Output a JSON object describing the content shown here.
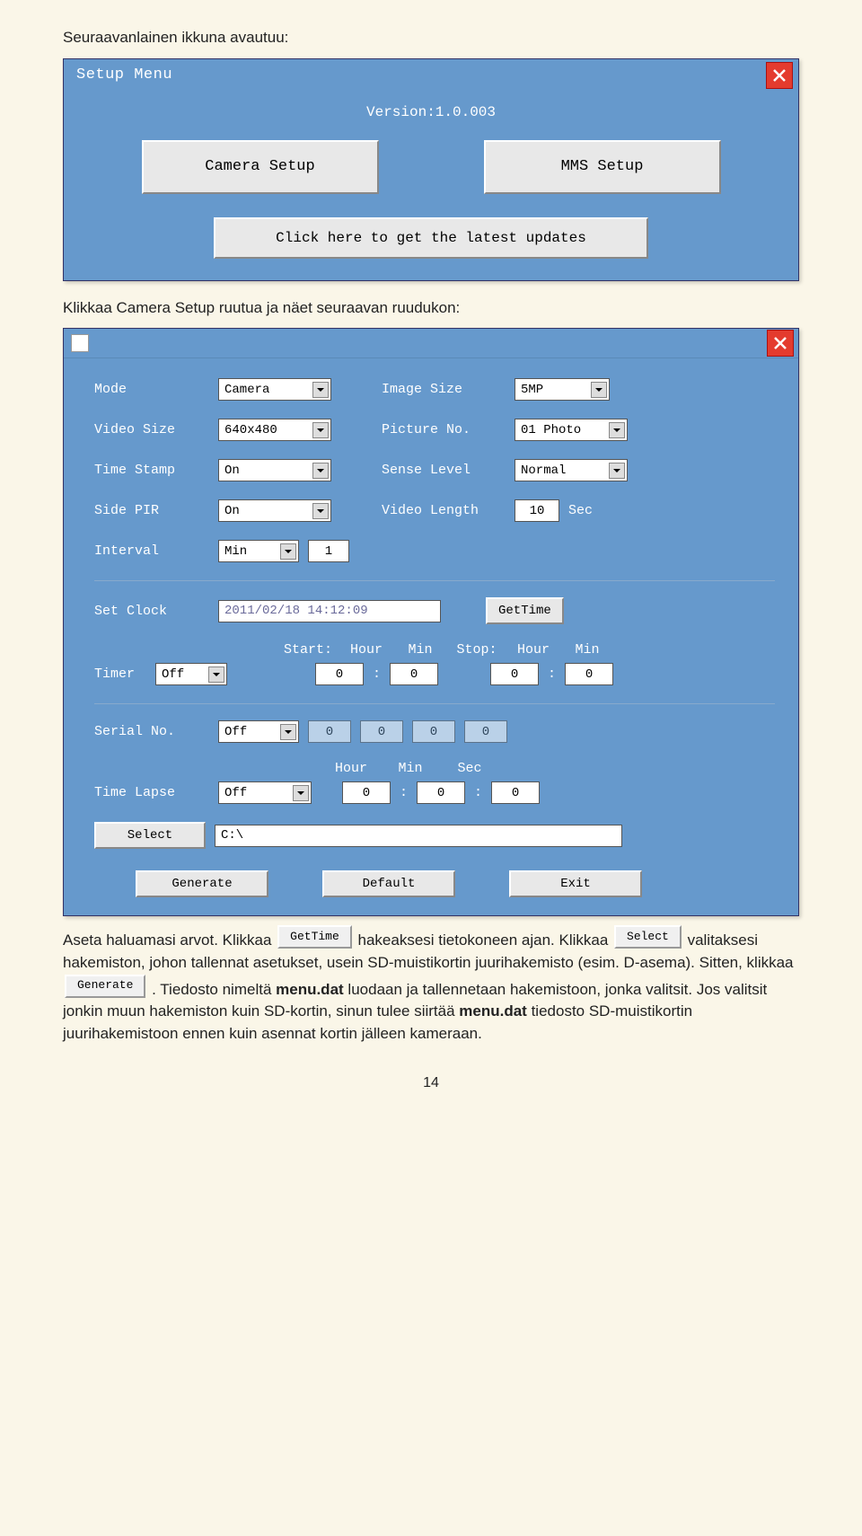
{
  "doc": {
    "intro": "Seuraavanlainen ikkuna avautuu:",
    "after_setup": "Klikkaa Camera Setup ruutua ja näet seuraavan ruudukon:",
    "para1_a": "Aseta haluamasi arvot. Klikkaa ",
    "para1_b": " hakeaksesi tietokoneen ajan. Klikkaa ",
    "para1_c": " valitaksesi hakemiston, johon tallennat asetukset, usein SD-muistikortin juurihakemisto (esim. D-asema). Sitten, klikkaa ",
    "para1_d": ". Tiedosto nimeltä ",
    "menu_dat": "menu.dat",
    "para1_e": " luodaan ja tallennetaan hakemistoon, jonka valitsit. Jos valitsit jonkin muun hakemiston kuin SD-kortin, sinun tulee siirtää ",
    "para1_f": " tiedosto SD-muistikortin juurihakemistoon ennen kuin asennat kortin jälleen kameraan.",
    "page_number": "14"
  },
  "setup_menu": {
    "title": "Setup Menu",
    "version": "Version:1.0.003",
    "camera_setup": "Camera Setup",
    "mms_setup": "MMS Setup",
    "updates": "Click here to get the latest updates"
  },
  "form": {
    "mode_lbl": "Mode",
    "mode_val": "Camera",
    "img_lbl": "Image Size",
    "img_val": "5MP",
    "vid_lbl": "Video Size",
    "vid_val": "640x480",
    "pic_lbl": "Picture No.",
    "pic_val": "01 Photo",
    "ts_lbl": "Time Stamp",
    "ts_val": "On",
    "sense_lbl": "Sense Level",
    "sense_val": "Normal",
    "pir_lbl": "Side PIR",
    "pir_val": "On",
    "vlen_lbl": "Video Length",
    "vlen_val": "10",
    "sec": "Sec",
    "int_lbl": "Interval",
    "int_val": "Min",
    "int_num": "1",
    "clk_lbl": "Set Clock",
    "clk_val": "2011/02/18 14:12:09",
    "gettime": "GetTime",
    "start": "Start:",
    "stop": "Stop:",
    "hour": "Hour",
    "min": "Min",
    "timer_lbl": "Timer",
    "timer_val": "Off",
    "sh": "0",
    "sm": "0",
    "eh": "0",
    "em": "0",
    "serial_lbl": "Serial No.",
    "serial_val": "Off",
    "s0": "0",
    "tl_lbl": "Time Lapse",
    "tl_val": "Off",
    "tlh": "0",
    "tlm": "0",
    "tls": "0",
    "select": "Select",
    "path": "C:\\",
    "generate": "Generate",
    "default": "Default",
    "exit": "Exit",
    "colon": ":",
    "sec2": "Sec"
  },
  "inline": {
    "gettime": "GetTime",
    "select": "Select",
    "generate": "Generate"
  }
}
